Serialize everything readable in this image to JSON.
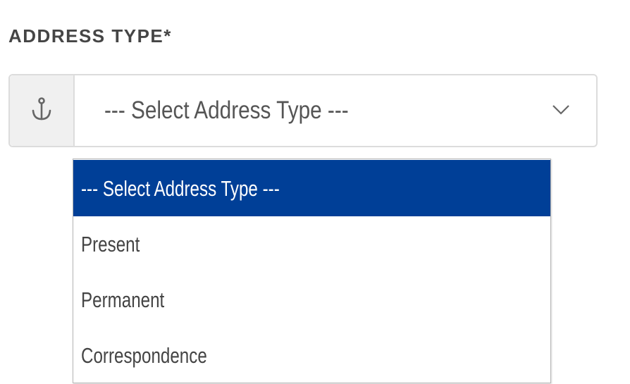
{
  "field": {
    "label": "ADDRESS TYPE*",
    "icon": "anchor-icon",
    "selected_value": "--- Select Address Type ---"
  },
  "dropdown": {
    "highlight_color": "#003f97",
    "options": [
      {
        "label": "--- Select Address Type ---",
        "highlighted": true
      },
      {
        "label": "Present",
        "highlighted": false
      },
      {
        "label": "Permanent",
        "highlighted": false
      },
      {
        "label": "Correspondence",
        "highlighted": false
      }
    ]
  }
}
